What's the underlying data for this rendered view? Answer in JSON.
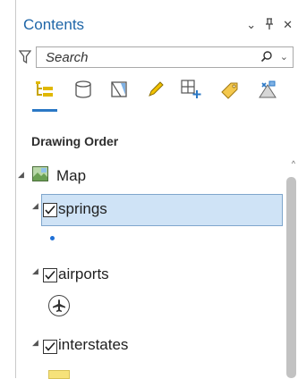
{
  "pane": {
    "title": "Contents",
    "controls": {
      "menu_glyph": "⌄",
      "pin_glyph": "ᵽ",
      "close_glyph": "✕"
    }
  },
  "search": {
    "placeholder": "Search"
  },
  "toolbar": {
    "buttons": [
      "list-by-drawing-order-icon",
      "list-by-data-source-icon",
      "list-by-selection-icon",
      "list-by-editing-icon",
      "list-by-snapping-icon",
      "list-by-labeling-icon",
      "list-by-perspective-imagery-icon"
    ],
    "active_index": 0
  },
  "section": {
    "title": "Drawing Order"
  },
  "tree": {
    "map": {
      "label": "Map"
    },
    "layers": [
      {
        "label": "springs",
        "checked": true,
        "selected": true,
        "symbol": "point"
      },
      {
        "label": "airports",
        "checked": true,
        "selected": false,
        "symbol": "airport-icon"
      },
      {
        "label": "interstates",
        "checked": true,
        "selected": false,
        "symbol": "polygon"
      }
    ]
  },
  "colors": {
    "accent": "#2b78c5",
    "title": "#1f66a8",
    "selection": "#cfe3f6",
    "point": "#1f6fd6"
  }
}
